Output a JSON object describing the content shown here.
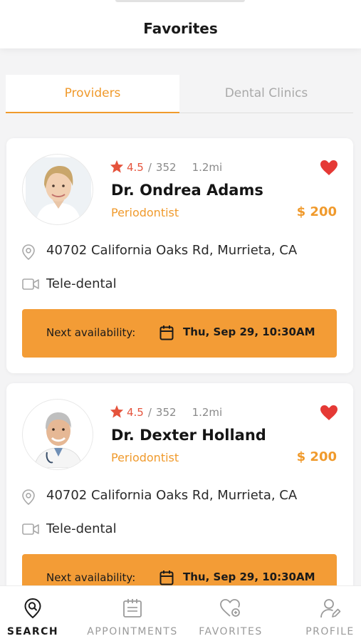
{
  "header": {
    "title": "Favorites"
  },
  "tabs": [
    {
      "label": "Providers",
      "active": true
    },
    {
      "label": "Dental Clinics",
      "active": false
    }
  ],
  "providers": [
    {
      "rating": "4.5",
      "reviews": "352",
      "distance": "1.2mi",
      "name": "Dr. Ondrea Adams",
      "specialty": "Periodontist",
      "price": "$ 200",
      "address": "40702 California Oaks Rd, Murrieta, CA",
      "service": "Tele-dental",
      "availability_label": "Next availability:",
      "availability_date": "Thu, Sep 29, 10:30AM",
      "favorited": true,
      "avatar_icon": "female-doctor-photo"
    },
    {
      "rating": "4.5",
      "reviews": "352",
      "distance": "1.2mi",
      "name": "Dr. Dexter Holland",
      "specialty": "Periodontist",
      "price": "$ 200",
      "address": "40702 California Oaks Rd, Murrieta, CA",
      "service": "Tele-dental",
      "availability_label": "Next availability:",
      "availability_date": "Thu, Sep 29, 10:30AM",
      "favorited": true,
      "avatar_icon": "male-doctor-photo"
    }
  ],
  "bottom_nav": [
    {
      "label": "SEARCH",
      "icon": "search-pin-icon",
      "active": true
    },
    {
      "label": "APPOINTMENTS",
      "icon": "calendar-list-icon",
      "active": false
    },
    {
      "label": "FAVORITES",
      "icon": "heart-icon",
      "active": false
    },
    {
      "label": "PROFILE",
      "icon": "user-edit-icon",
      "active": false
    }
  ],
  "colors": {
    "accent": "#f09a2c",
    "button": "#f39c36",
    "star": "#e5533c",
    "heart": "#e53935",
    "background": "#f4f4f5"
  }
}
